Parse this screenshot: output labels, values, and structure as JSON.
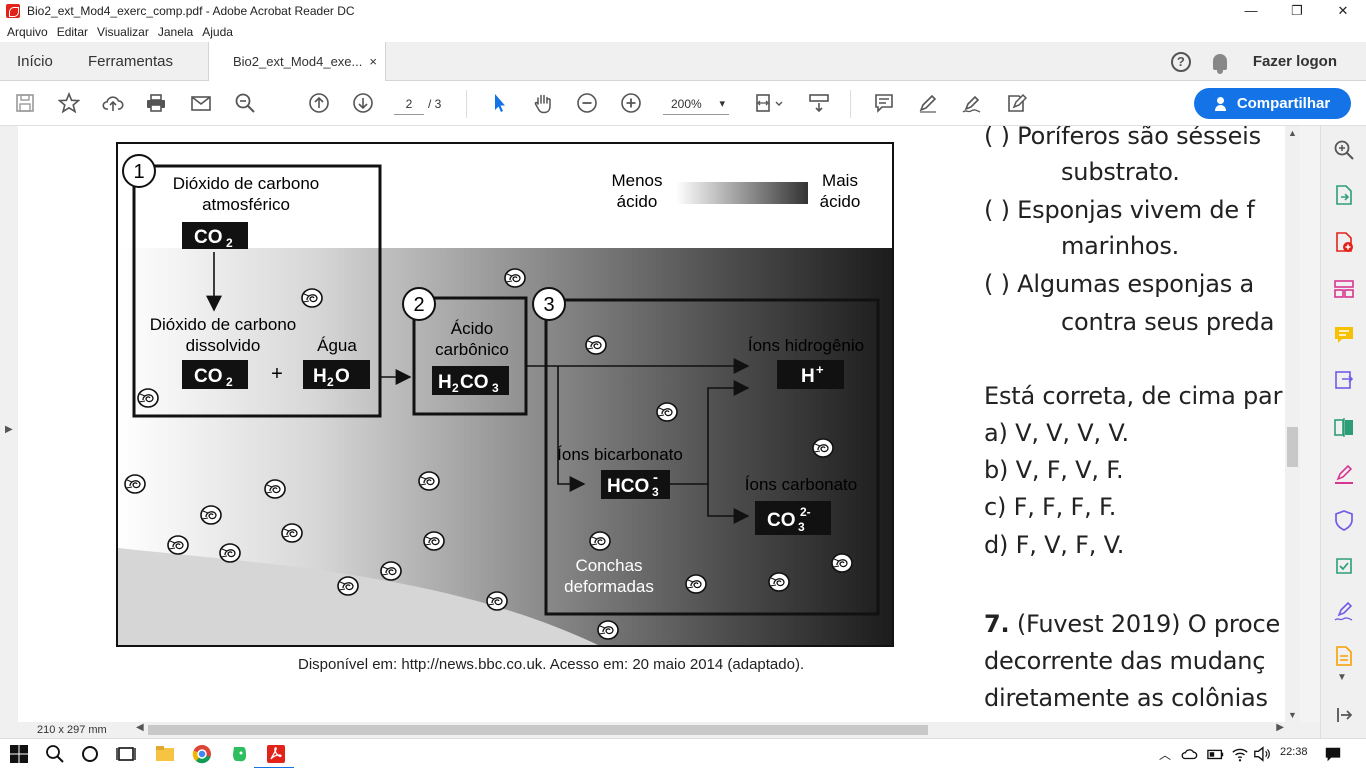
{
  "window": {
    "title": "Bio2_ext_Mod4_exerc_comp.pdf - Adobe Acrobat Reader DC",
    "controls": {
      "minimize": "—",
      "restore": "❐",
      "close": "✕"
    }
  },
  "menu": [
    "Arquivo",
    "Editar",
    "Visualizar",
    "Janela",
    "Ajuda"
  ],
  "tabs": {
    "home": "Início",
    "tools": "Ferramentas",
    "document": "Bio2_ext_Mod4_exe...",
    "close": "×",
    "login": "Fazer logon",
    "help": "?"
  },
  "toolbar": {
    "page_current": "2",
    "page_total": "/ 3",
    "zoom": "200%",
    "share_label": "Compartilhar"
  },
  "figure": {
    "scale": {
      "less": [
        "Menos",
        "ácido"
      ],
      "more": [
        "Mais",
        "ácido"
      ]
    },
    "box1": {
      "number": "1",
      "atm_label": [
        "Dióxido de carbono",
        "atmosférico"
      ],
      "atm_formula": "CO",
      "dissolved_label": [
        "Dióxido de carbono",
        "dissolvido"
      ],
      "dissolved_formula": "CO",
      "plus": "+",
      "water_label": "Água",
      "water_formula": "H",
      "sub2": "2",
      "water_tail": "O"
    },
    "box2": {
      "number": "2",
      "label": [
        "Ácido",
        "carbônico"
      ],
      "formula_a": "H",
      "formula_b": "CO",
      "sub2": "2",
      "sub3": "3"
    },
    "box3": {
      "number": "3",
      "hydrogen_label": "Íons hidrogênio",
      "hydrogen_formula": "H",
      "plus_sign": "+",
      "bicarbonate_label": "Íons bicarbonato",
      "bicarbonate_formula": "HCO",
      "minus_sign": "-",
      "sub3": "3",
      "carbonate_label": "Íons carbonato",
      "carbonate_formula": "CO",
      "charge_2minus": "2-",
      "shells_label": [
        "Conchas",
        "deformadas"
      ]
    },
    "caption": "Disponível em: http://news.bbc.co.uk. Acesso em: 20 maio 2014 (adaptado)."
  },
  "question": {
    "lines": [
      "(      ) Poríferos são sésseis",
      "substrato.",
      "(      ) Esponjas vivem de f",
      "marinhos.",
      "(      ) Algumas esponjas a",
      "contra seus preda",
      "Está correta, de cima par",
      "a) V, V, V, V.",
      "b) V, F, V, F.",
      "c) F, F, F, F.",
      "d) F, V, F, V."
    ],
    "next_number": "7.",
    "next_lines": [
      "(Fuvest 2019)  O proce",
      "decorrente das mudanç",
      "diretamente as colônias"
    ]
  },
  "status": {
    "page_size": "210 x 297 mm"
  },
  "taskbar": {
    "time": "22:38"
  },
  "colors": {
    "accent": "#1473e6",
    "acrobat_red": "#e2231a"
  }
}
